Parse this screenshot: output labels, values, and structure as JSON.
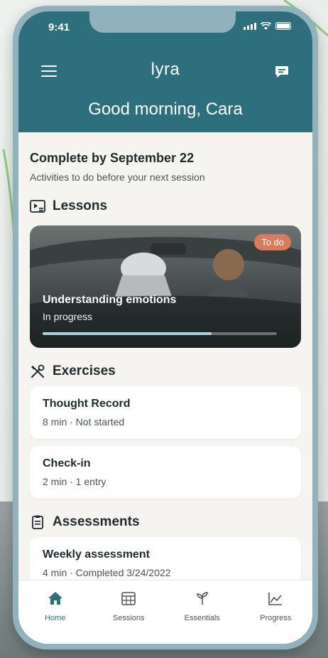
{
  "status": {
    "time": "9:41"
  },
  "header": {
    "logo": "lyra",
    "greeting": "Good morning, Cara"
  },
  "due": {
    "title": "Complete by September 22",
    "subtitle": "Activities to do before your next session"
  },
  "lessons": {
    "heading": "Lessons",
    "card": {
      "badge": "To do",
      "title": "Understanding emotions",
      "status": "In progress",
      "progress": 0.72
    }
  },
  "exercises": {
    "heading": "Exercises",
    "items": [
      {
        "title": "Thought Record",
        "meta": "8 min · Not started"
      },
      {
        "title": "Check-in",
        "meta": "2 min · 1 entry"
      }
    ]
  },
  "assessments": {
    "heading": "Assessments",
    "items": [
      {
        "title": "Weekly assessment",
        "meta": "4 min · Completed 3/24/2022"
      }
    ]
  },
  "tabs": [
    {
      "label": "Home",
      "icon": "home-icon",
      "active": true
    },
    {
      "label": "Sessions",
      "icon": "calendar-icon",
      "active": false
    },
    {
      "label": "Essentials",
      "icon": "sprout-icon",
      "active": false
    },
    {
      "label": "Progress",
      "icon": "chart-icon",
      "active": false
    }
  ],
  "colors": {
    "header": "#2e6f7d",
    "badge": "#d97a5c",
    "background": "#f6f4f1",
    "frame": "#8fb2bd"
  }
}
